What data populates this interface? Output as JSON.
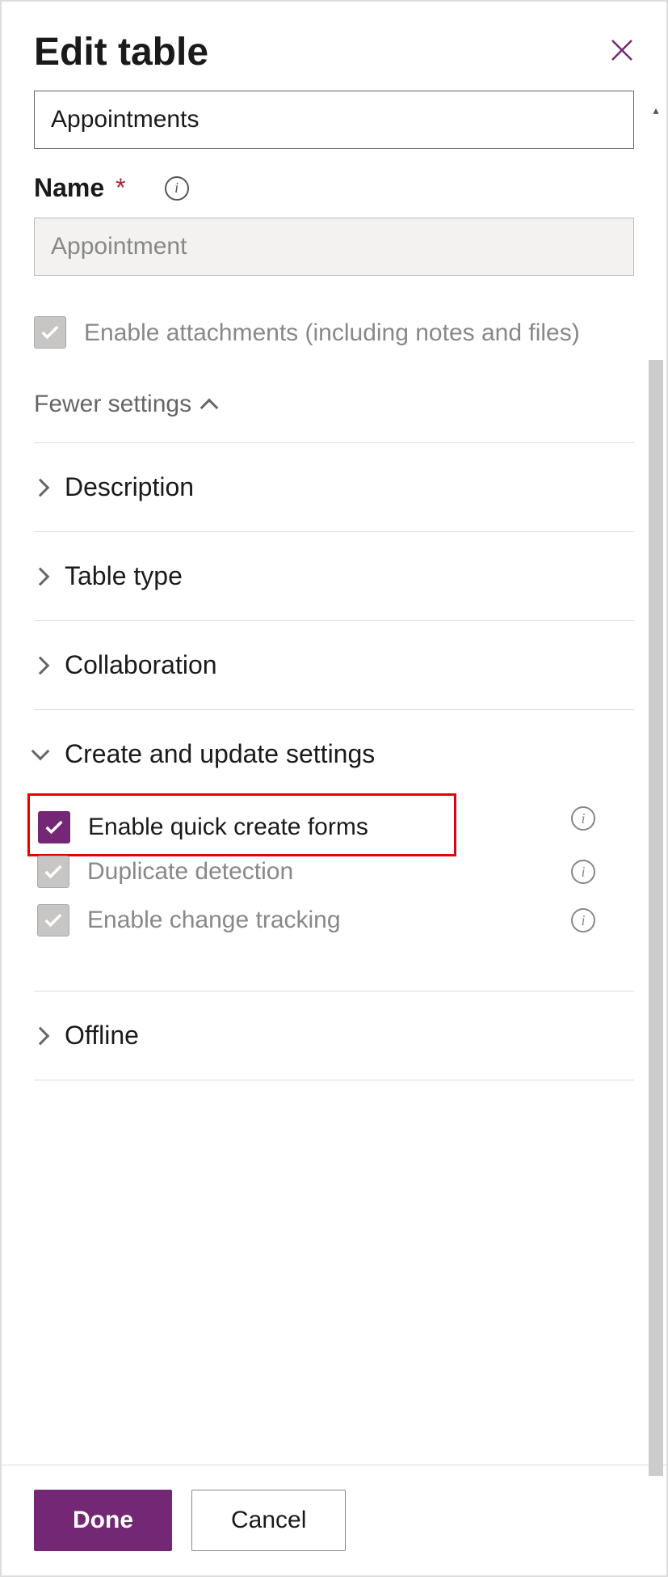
{
  "header": {
    "title": "Edit table"
  },
  "fields": {
    "display_name_value": "Appointments",
    "name_label": "Name",
    "name_value": "Appointment",
    "attachments_label": "Enable attachments (including notes and files)"
  },
  "toggle": {
    "fewer_settings": "Fewer settings"
  },
  "sections": {
    "description": "Description",
    "table_type": "Table type",
    "collaboration": "Collaboration",
    "create_update": "Create and update settings",
    "offline": "Offline"
  },
  "create_update_options": {
    "quick_create": "Enable quick create forms",
    "duplicate_detection": "Duplicate detection",
    "change_tracking": "Enable change tracking"
  },
  "footer": {
    "done": "Done",
    "cancel": "Cancel"
  }
}
